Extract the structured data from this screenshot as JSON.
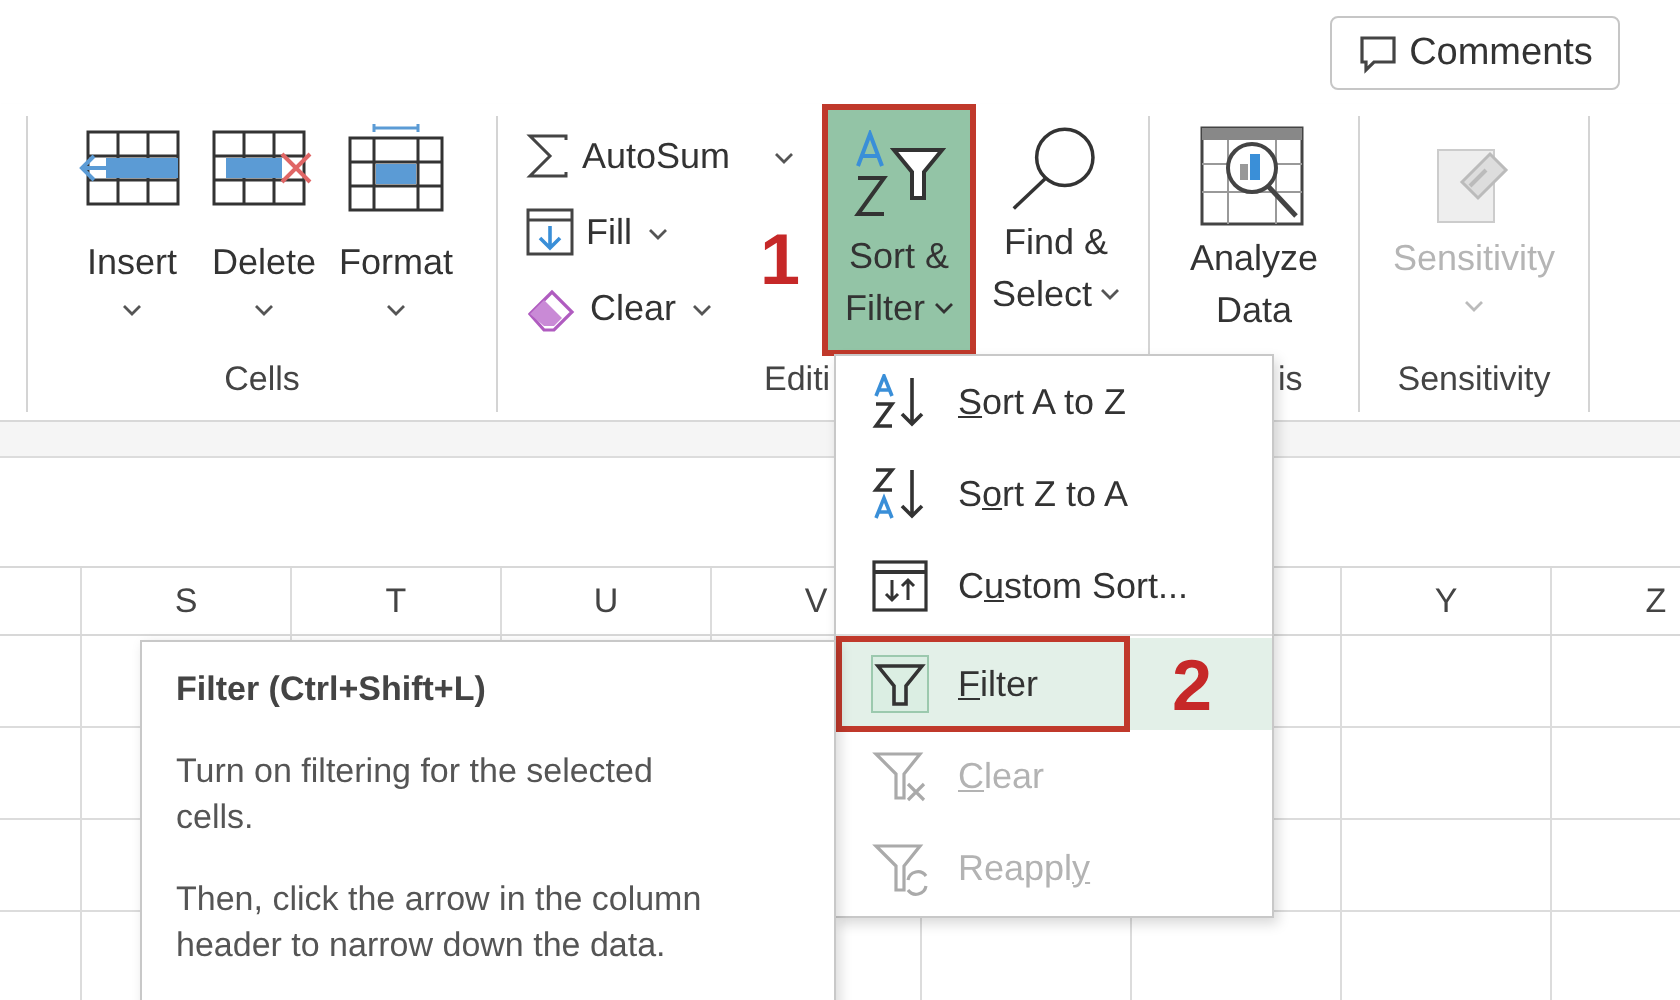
{
  "comments_button": {
    "label": "Comments"
  },
  "ribbon": {
    "cells_group": {
      "label": "Cells",
      "buttons": [
        {
          "label": "Insert",
          "dropdown": true
        },
        {
          "label": "Delete",
          "dropdown": true
        },
        {
          "label": "Format",
          "dropdown": true
        }
      ]
    },
    "editing_group": {
      "label": "Editi",
      "small_buttons": [
        {
          "label": "AutoSum",
          "dropdown": true
        },
        {
          "label": "Fill",
          "dropdown": true
        },
        {
          "label": "Clear",
          "dropdown": true
        }
      ],
      "sort_filter_button": {
        "label_lines": [
          "Sort &",
          "Filter"
        ],
        "dropdown": true,
        "pressed": true
      },
      "find_select_button": {
        "label_lines": [
          "Find &",
          "Select"
        ],
        "dropdown": true
      }
    },
    "analysis_group": {
      "label": "is",
      "button": {
        "label_lines": [
          "Analyze",
          "Data"
        ]
      }
    },
    "sensitivity_group": {
      "label": "Sensitivity",
      "button": {
        "label": "Sensitivity",
        "dropdown": true,
        "disabled": true
      }
    }
  },
  "annotations": [
    {
      "label": "1"
    },
    {
      "label": "2"
    }
  ],
  "column_headers": {
    "left": [
      "S",
      "T",
      "U",
      "V"
    ],
    "right": [
      "Y",
      "Z"
    ]
  },
  "sort_filter_menu": {
    "items": [
      {
        "key": "S",
        "after": "ort A to Z",
        "selected": false,
        "disabled": false
      },
      {
        "before": "S",
        "key": "o",
        "after": "rt Z to A",
        "selected": false,
        "disabled": false
      },
      {
        "before": "C",
        "key": "u",
        "after": "stom Sort...",
        "selected": false,
        "disabled": false
      },
      {
        "key": "F",
        "after": "ilter",
        "selected": true,
        "disabled": false
      },
      {
        "key": "C",
        "after": "lear",
        "selected": false,
        "disabled": true
      },
      {
        "before": "Reappl",
        "key": "y",
        "selected": false,
        "disabled": true
      }
    ]
  },
  "tooltip": {
    "title": "Filter (Ctrl+Shift+L)",
    "paragraphs": [
      "Turn on filtering for the selected cells.",
      "Then, click the arrow in the column header to narrow down the data."
    ]
  }
}
